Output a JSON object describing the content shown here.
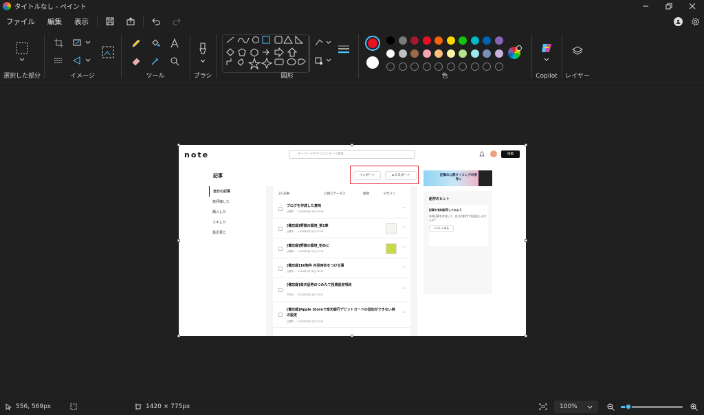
{
  "window": {
    "title": "タイトルなし - ペイント"
  },
  "menu": {
    "file": "ファイル",
    "edit": "編集",
    "view": "表示"
  },
  "ribbon": {
    "selection_label": "選択した部分",
    "image_label": "イメージ",
    "tools_label": "ツール",
    "brush_label": "ブラシ",
    "shapes_label": "図形",
    "color_label": "色",
    "copilot_label": "Copilot",
    "layers_label": "レイヤー",
    "primary_color": "#e81123",
    "secondary_color": "#ffffff",
    "palette_row1": [
      "#000000",
      "#7a7a7a",
      "#a01a2d",
      "#e81123",
      "#f7630c",
      "#ffd600",
      "#16c60c",
      "#00b7c3",
      "#0063b1",
      "#8764b8"
    ],
    "palette_row2": [
      "#ffffff",
      "#c0c0c0",
      "#9a6a4a",
      "#f4a6b0",
      "#fdbf7e",
      "#fff4a3",
      "#b5e48c",
      "#a0e6f0",
      "#7b8fbd",
      "#c6b3e0"
    ]
  },
  "canvas_image": {
    "logo": "note",
    "search_placeholder": "キーワードやクリエイターで検索",
    "post_button": "投稿",
    "page_title": "記事",
    "side_items": [
      "自分の記事",
      "高評価した",
      "購入した",
      "スキした",
      "最近見た"
    ],
    "import_button": "インポート",
    "export_button": "エクスポート",
    "article_count": "22 記事",
    "filter_status": "公開ステータス",
    "filter_period": "期間",
    "filter_magazine": "マガジン",
    "articles": [
      {
        "title": "ブログを作成した意味",
        "meta": "公開中 ・ 2024年9月15日 09:28"
      },
      {
        "title": "[備忘録]野菜の栽培_第1章",
        "meta": "公開中 ・ 2024年9月24日 07:05"
      },
      {
        "title": "[備忘録]野菜の栽培_初めに",
        "meta": "公開中 ・ 2024年9月19日 07:19"
      },
      {
        "title": "[備忘録]1K物件 内見時気をつける事",
        "meta": "公開中 ・ 2024年9月16日 08:31"
      },
      {
        "title": "[備忘録]楽天証券のつみたて投資設定項目",
        "meta": "下書き ・ 2024年9月16日 15:21"
      },
      {
        "title": "[備忘録]Apple Storeで楽天銀行デビットカードの追加ができない時の設定",
        "meta": "公開中 ・ 2024年9月12日 20:02"
      }
    ],
    "banner_text": "記事の公開タイミングの参考に",
    "hint_title": "創作のヒント",
    "hint_heading": "記事を有料販売してみよう",
    "hint_body": "有料記事を作成して、自分の創作で収益化しませんか？",
    "hint_button": "くわしくみる"
  },
  "status": {
    "cursor_position": "556, 569px",
    "canvas_size": "1420 × 775px",
    "zoom": "100%",
    "zoom_fraction": 0.12
  }
}
